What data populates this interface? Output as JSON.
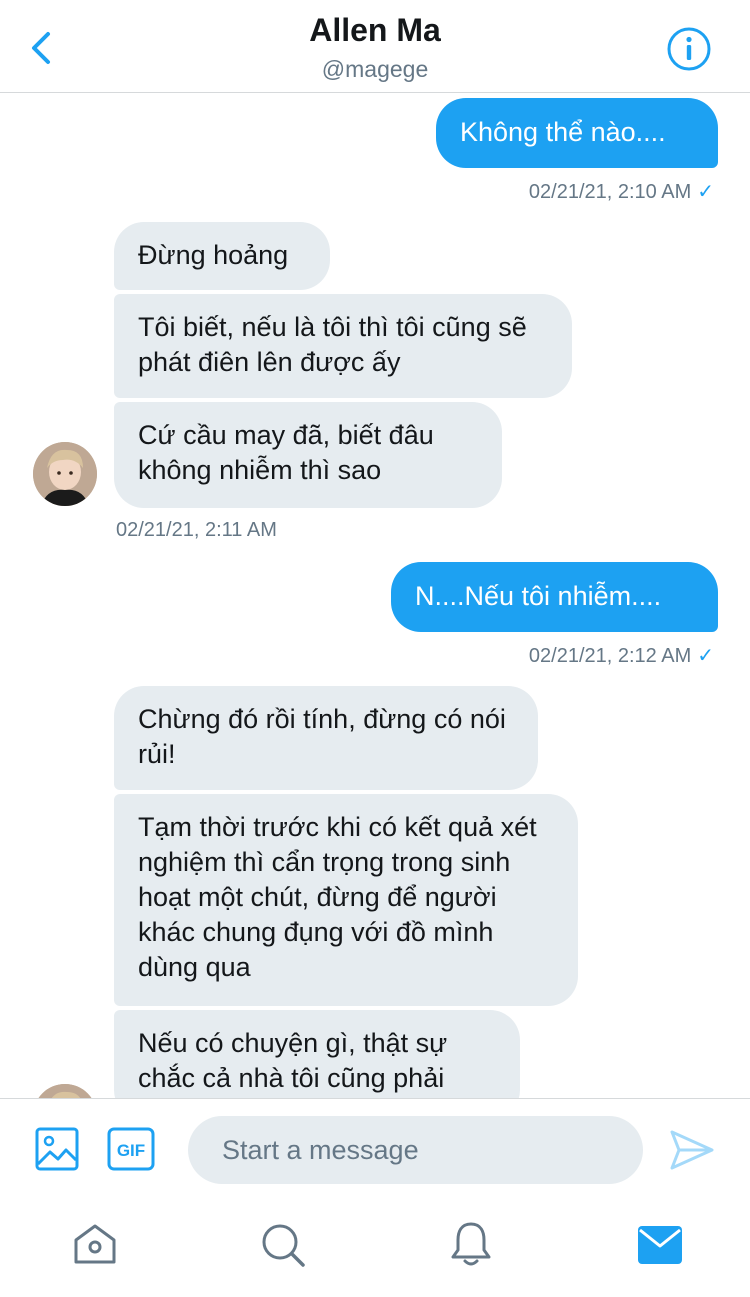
{
  "header": {
    "name": "Allen Ma",
    "handle": "@magege"
  },
  "messages": [
    {
      "dir": "out",
      "text": "Không thể nào...."
    },
    {
      "dir": "out_ts",
      "text": "02/21/21, 2:10 AM",
      "read": "✓"
    },
    {
      "dir": "in",
      "text": "Đừng hoảng"
    },
    {
      "dir": "in",
      "text": "Tôi biết, nếu là tôi thì tôi cũng sẽ phát điên lên được ấy"
    },
    {
      "dir": "in",
      "text": "Cứ cầu may đã, biết đâu không nhiễm thì sao"
    },
    {
      "dir": "in_ts",
      "text": "02/21/21, 2:11 AM"
    },
    {
      "dir": "out",
      "text": "N....Nếu tôi nhiễm...."
    },
    {
      "dir": "out_ts",
      "text": "02/21/21, 2:12 AM",
      "read": "✓"
    },
    {
      "dir": "in",
      "text": "Chừng đó rồi tính, đừng có nói rủi!"
    },
    {
      "dir": "in",
      "text": "Tạm thời trước khi có kết quả xét nghiệm thì cẩn trọng trong sinh hoạt một chút, đừng để người khác chung đụng với đồ mình dùng qua"
    },
    {
      "dir": "in",
      "text": "Nếu có chuyện gì, thật sự chắc cả nhà tôi cũng phải"
    }
  ],
  "composer": {
    "placeholder": "Start a message",
    "gif_label": "GIF"
  },
  "colors": {
    "accent": "#1da1f2",
    "incoming_bubble": "#e6ecf0",
    "meta_text": "#657786"
  },
  "icons": {
    "back": "chevron-left-icon",
    "info": "info-icon",
    "media": "image-icon",
    "gif": "gif-icon",
    "send": "send-icon",
    "home": "home-icon",
    "search": "search-icon",
    "notifications": "bell-icon",
    "messages": "mail-icon"
  }
}
